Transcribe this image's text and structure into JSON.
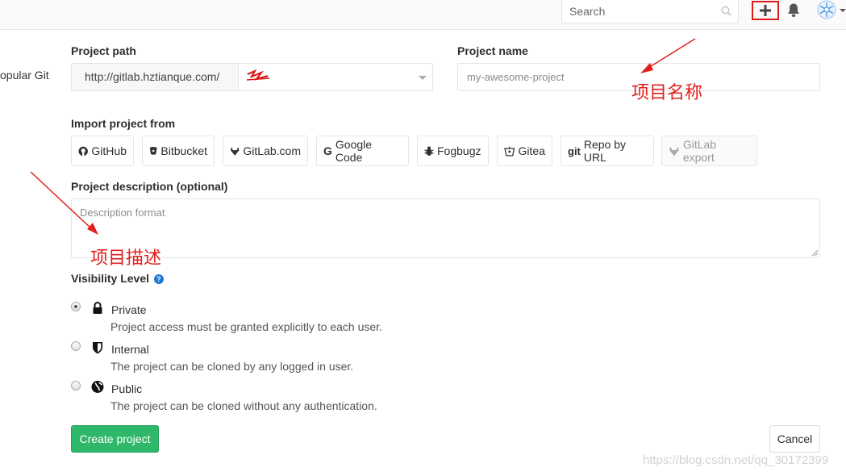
{
  "header": {
    "search_placeholder": "Search",
    "icons": [
      "search-icon",
      "plus-icon",
      "bell-icon",
      "avatar"
    ]
  },
  "left_clipped_text": "opular Git",
  "form": {
    "path_label": "Project path",
    "path_prefix": "http://gitlab.hztianque.com/",
    "name_label": "Project name",
    "name_placeholder": "my-awesome-project",
    "import_label": "Import project from",
    "import_sources": [
      {
        "label": "GitHub",
        "icon": "github-icon"
      },
      {
        "label": "Bitbucket",
        "icon": "bitbucket-icon"
      },
      {
        "label": "GitLab.com",
        "icon": "gitlab-icon"
      },
      {
        "label": "Google Code",
        "icon": "google-icon"
      },
      {
        "label": "Fogbugz",
        "icon": "bug-icon"
      },
      {
        "label": "Gitea",
        "icon": "gitea-icon"
      },
      {
        "label": "Repo by URL",
        "icon": "git-icon"
      },
      {
        "label": "GitLab export",
        "icon": "gitlab-icon",
        "disabled": true
      }
    ],
    "description_label": "Project description (optional)",
    "description_placeholder": "Description format",
    "visibility_label": "Visibility Level",
    "visibility_options": [
      {
        "title": "Private",
        "desc": "Project access must be granted explicitly to each user.",
        "checked": true,
        "icon": "lock-icon"
      },
      {
        "title": "Internal",
        "desc": "The project can be cloned by any logged in user.",
        "checked": false,
        "icon": "shield-icon"
      },
      {
        "title": "Public",
        "desc": "The project can be cloned without any authentication.",
        "checked": false,
        "icon": "globe-icon"
      }
    ],
    "create_label": "Create project",
    "cancel_label": "Cancel"
  },
  "annotations": {
    "project_name_note": "项目名称",
    "project_desc_note": "项目描述"
  },
  "watermark": "https://blog.csdn.net/qq_30172399",
  "colors": {
    "create_button": "#2fb86a",
    "annotation": "#e0201c",
    "help_icon": "#1f78d1"
  }
}
